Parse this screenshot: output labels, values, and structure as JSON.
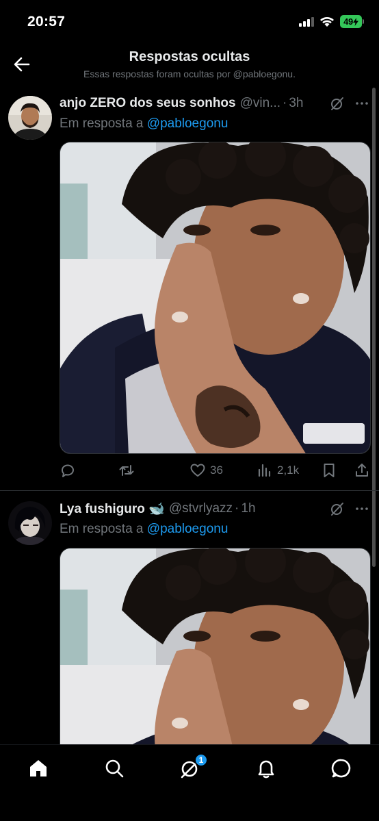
{
  "status_bar": {
    "time": "20:57",
    "battery": "49",
    "icons": [
      "signal-icon",
      "wifi-icon",
      "battery-icon",
      "charging-icon"
    ]
  },
  "header": {
    "title": "Respostas ocultas",
    "subtitle": "Essas respostas foram ocultas por @pabloegonu.",
    "back_icon": "back-arrow-icon"
  },
  "tweets": [
    {
      "display_name": "anjo ZERO dos seus sonhos",
      "handle": "@vin...",
      "time": "3h",
      "reply_prefix": "Em resposta a",
      "reply_to": "@pabloegonu",
      "actions": {
        "replies": "",
        "retweets": "",
        "likes": "36",
        "views": "2,1k"
      }
    },
    {
      "display_name": "Lya fushiguro 🐋",
      "handle": "@stvrlyazz",
      "time": "1h",
      "reply_prefix": "Em resposta a",
      "reply_to": "@pabloegonu"
    }
  ],
  "bottom_nav": {
    "items": [
      "home-icon",
      "search-icon",
      "grok-icon",
      "notifications-icon",
      "messages-icon"
    ],
    "badge": "1"
  },
  "colors": {
    "background": "#000000",
    "accent": "#1d9bf0",
    "muted": "#71767b",
    "text": "#e7e9ea",
    "battery": "#34c759"
  }
}
